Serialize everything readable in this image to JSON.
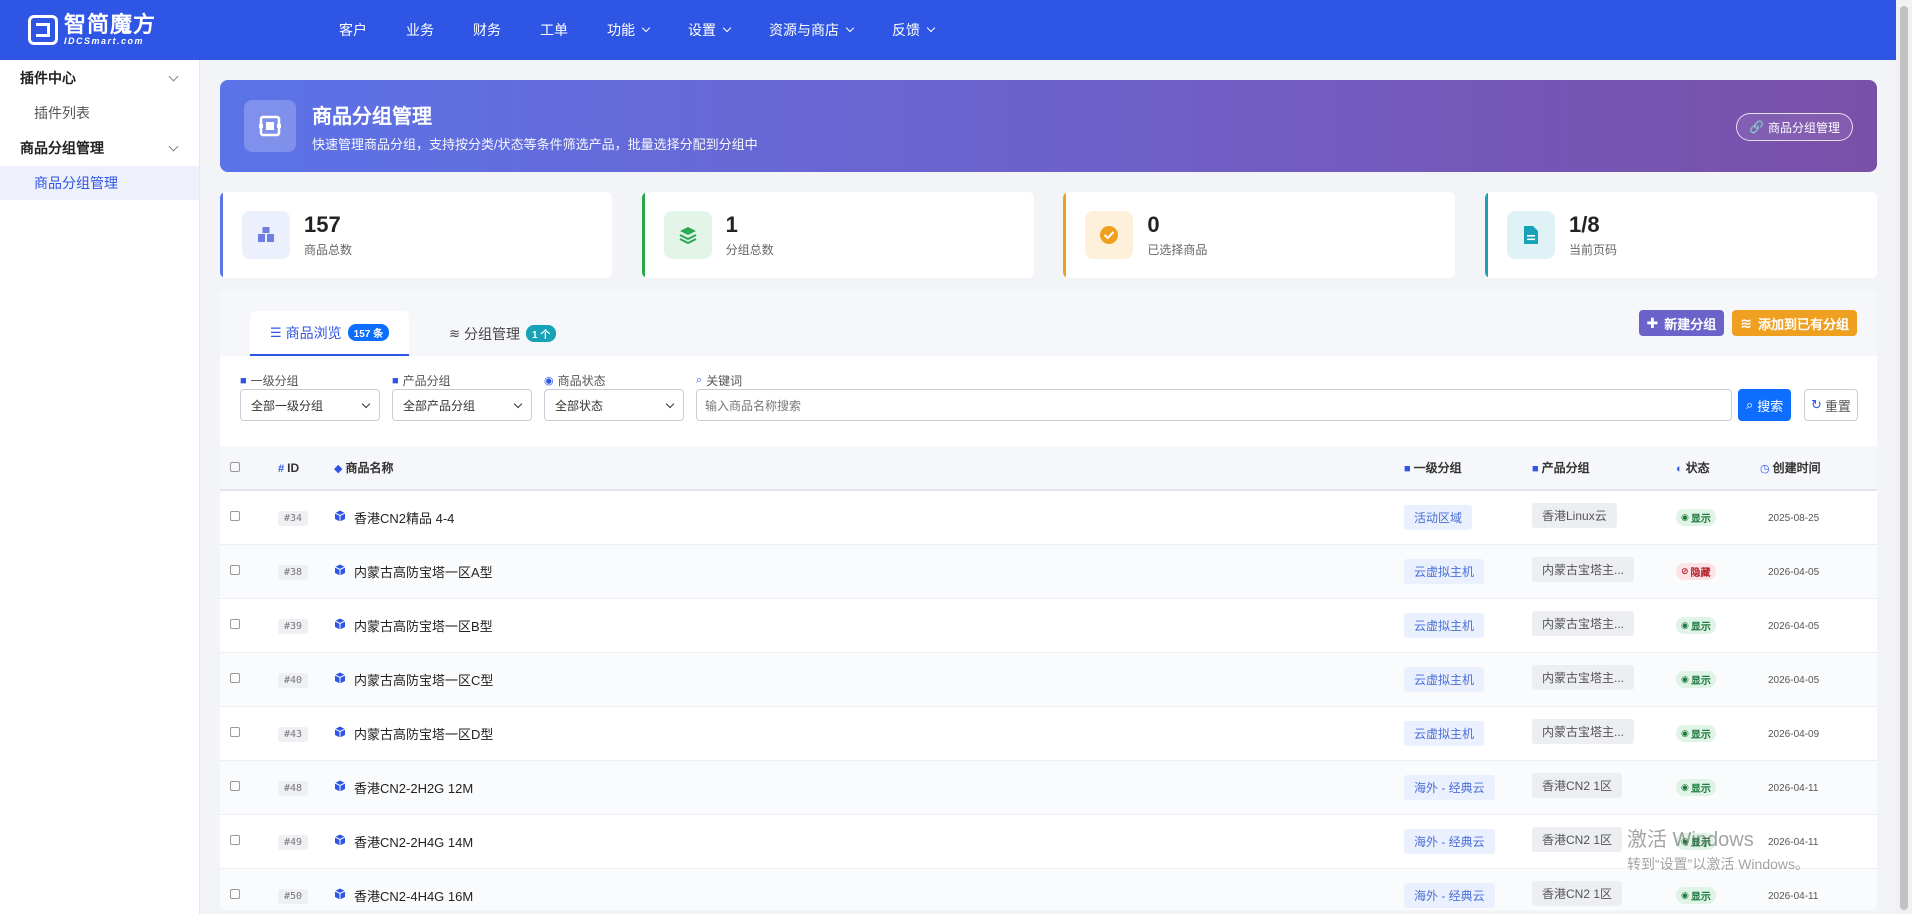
{
  "brand": {
    "name_cn": "智简魔方",
    "name_en": "IDCSmart.com"
  },
  "nav": [
    {
      "label": "客户",
      "dropdown": false
    },
    {
      "label": "业务",
      "dropdown": false
    },
    {
      "label": "财务",
      "dropdown": false
    },
    {
      "label": "工单",
      "dropdown": false
    },
    {
      "label": "功能",
      "dropdown": true
    },
    {
      "label": "设置",
      "dropdown": true
    },
    {
      "label": "资源与商店",
      "dropdown": true
    },
    {
      "label": "反馈",
      "dropdown": true
    }
  ],
  "sidebar": {
    "groups": [
      {
        "label": "插件中心",
        "items": [
          {
            "label": "插件列表",
            "active": false
          }
        ]
      },
      {
        "label": "商品分组管理",
        "items": [
          {
            "label": "商品分组管理",
            "active": true
          }
        ]
      }
    ]
  },
  "banner": {
    "title": "商品分组管理",
    "subtitle": "快速管理商品分组，支持按分类/状态等条件筛选产品，批量选择分配到分组中",
    "button": "商品分组管理"
  },
  "stats": [
    {
      "value": "157",
      "label": "商品总数",
      "color": "#5b73e8",
      "icon": "boxes-icon"
    },
    {
      "value": "1",
      "label": "分组总数",
      "color": "#28a745",
      "icon": "layers-icon"
    },
    {
      "value": "0",
      "label": "已选择商品",
      "color": "#f0a020",
      "icon": "check-circle-icon"
    },
    {
      "value": "1/8",
      "label": "当前页码",
      "color": "#17a2b8",
      "icon": "document-icon"
    }
  ],
  "tabs": [
    {
      "label": "商品浏览",
      "badge": "157 条",
      "badge_color": "#0d6efd",
      "active": true
    },
    {
      "label": "分组管理",
      "badge": "1 个",
      "badge_color": "#17a2b8",
      "active": false
    }
  ],
  "actions": {
    "new_group": "新建分组",
    "add_to_group": "添加到已有分组"
  },
  "filters": {
    "level1": {
      "label": "一级分组",
      "value": "全部一级分组"
    },
    "product_group": {
      "label": "产品分组",
      "value": "全部产品分组"
    },
    "status": {
      "label": "商品状态",
      "value": "全部状态"
    },
    "keyword": {
      "label": "关键词",
      "placeholder": "输入商品名称搜索"
    },
    "search_button": "搜索",
    "reset_button": "重置"
  },
  "table": {
    "headers": {
      "id": "ID",
      "name": "商品名称",
      "level1": "一级分组",
      "group": "产品分组",
      "status": "状态",
      "created": "创建时间"
    },
    "rows": [
      {
        "id": "#34",
        "name": "香港CN2精品 4-4",
        "level1": "活动区域",
        "group": "香港Linux云",
        "status": "显示",
        "hidden": false,
        "created": "2025-08-25"
      },
      {
        "id": "#38",
        "name": "内蒙古高防宝塔一区A型",
        "level1": "云虚拟主机",
        "group": "内蒙古宝塔主...",
        "status": "隐藏",
        "hidden": true,
        "created": "2026-04-05"
      },
      {
        "id": "#39",
        "name": "内蒙古高防宝塔一区B型",
        "level1": "云虚拟主机",
        "group": "内蒙古宝塔主...",
        "status": "显示",
        "hidden": false,
        "created": "2026-04-05"
      },
      {
        "id": "#40",
        "name": "内蒙古高防宝塔一区C型",
        "level1": "云虚拟主机",
        "group": "内蒙古宝塔主...",
        "status": "显示",
        "hidden": false,
        "created": "2026-04-05"
      },
      {
        "id": "#43",
        "name": "内蒙古高防宝塔一区D型",
        "level1": "云虚拟主机",
        "group": "内蒙古宝塔主...",
        "status": "显示",
        "hidden": false,
        "created": "2026-04-09"
      },
      {
        "id": "#48",
        "name": "香港CN2-2H2G 12M",
        "level1": "海外 - 经典云",
        "group": "香港CN2 1区",
        "status": "显示",
        "hidden": false,
        "created": "2026-04-11"
      },
      {
        "id": "#49",
        "name": "香港CN2-2H4G 14M",
        "level1": "海外 - 经典云",
        "group": "香港CN2 1区",
        "status": "显示",
        "hidden": false,
        "created": "2026-04-11"
      },
      {
        "id": "#50",
        "name": "香港CN2-4H4G 16M",
        "level1": "海外 - 经典云",
        "group": "香港CN2 1区",
        "status": "显示",
        "hidden": false,
        "created": "2026-04-11"
      }
    ]
  },
  "watermark": {
    "line1": "激活 Windows",
    "line2": "转到“设置”以激活 Windows。"
  }
}
